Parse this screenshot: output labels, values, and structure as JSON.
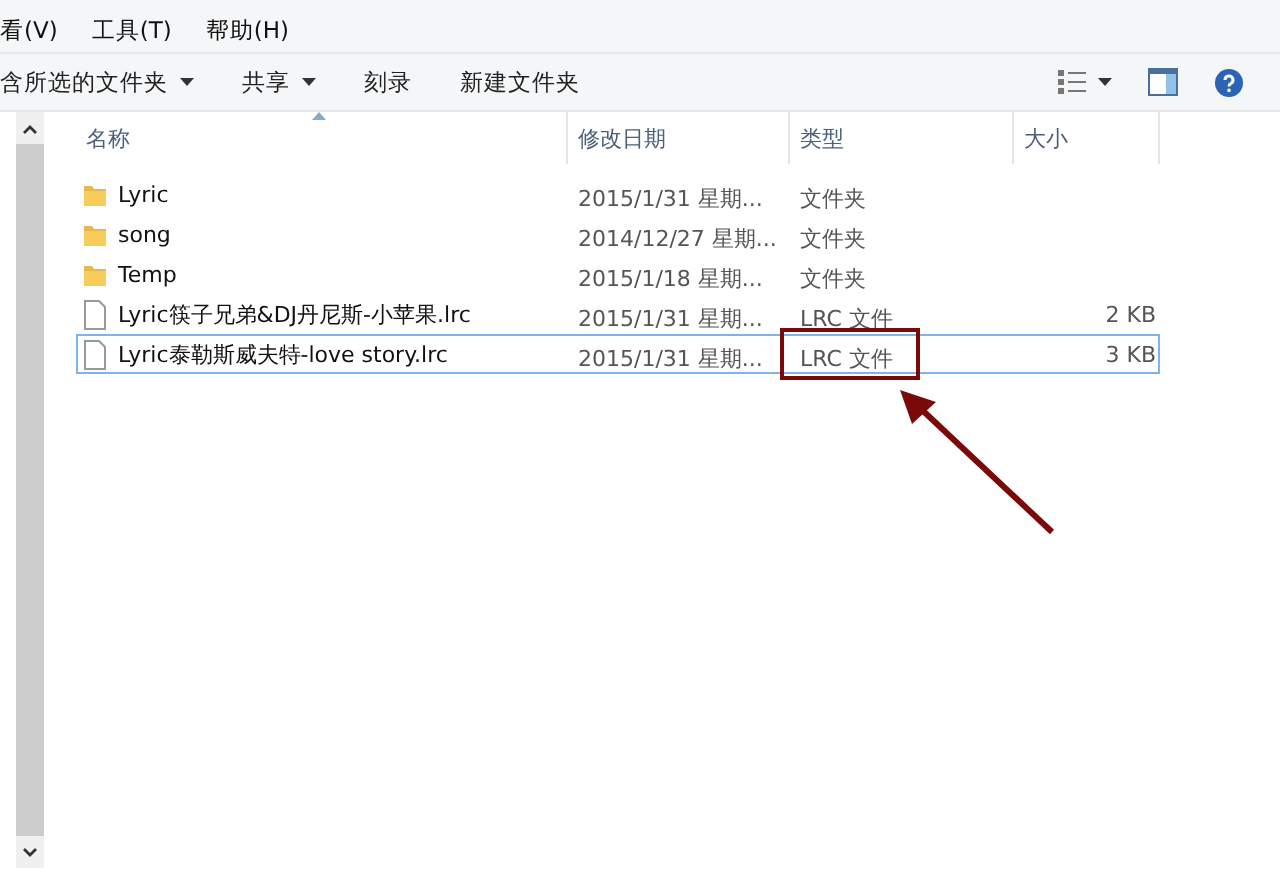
{
  "menu": [
    "看(V)",
    "工具(T)",
    "帮助(H)"
  ],
  "toolbar": [
    {
      "label": "含所选的文件夹",
      "dropdown": true
    },
    {
      "label": "共享",
      "dropdown": true
    },
    {
      "label": "刻录",
      "dropdown": false
    },
    {
      "label": "新建文件夹",
      "dropdown": false
    }
  ],
  "columns": [
    "名称",
    "修改日期",
    "类型",
    "大小"
  ],
  "rows": [
    {
      "kind": "folder",
      "name": "Lyric",
      "date": "2015/1/31 星期...",
      "type": "文件夹",
      "selected": false,
      "highlighted": false
    },
    {
      "kind": "folder",
      "name": "song",
      "date": "2014/12/27 星期...",
      "type": "文件夹",
      "selected": false,
      "highlighted": false
    },
    {
      "kind": "folder",
      "name": "Temp",
      "date": "2015/1/18 星期...",
      "type": "文件夹",
      "selected": false,
      "highlighted": false
    },
    {
      "kind": "file",
      "name": "Lyric筷子兄弟&DJ丹尼斯-小苹果.lrc",
      "date": "2015/1/31 星期...",
      "type": "LRC 文件",
      "size": "2 KB",
      "selected": false,
      "highlighted": false
    },
    {
      "kind": "file",
      "name": "Lyric泰勒斯威夫特-love story.lrc",
      "date": "2015/1/31 星期...",
      "type": "LRC 文件",
      "size": "3 KB",
      "selected": true,
      "highlighted": true
    }
  ]
}
